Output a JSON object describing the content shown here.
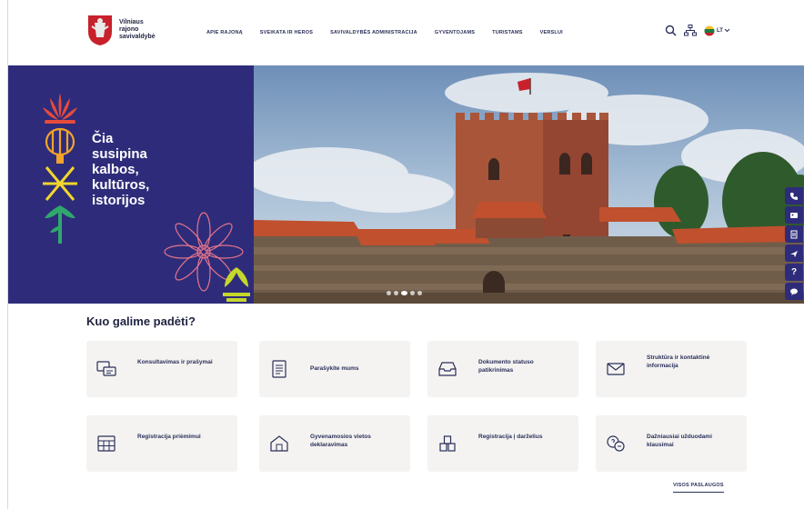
{
  "header": {
    "logo_lines": [
      "Vilniaus",
      "rajono",
      "savivaldybė"
    ],
    "nav": [
      "APIE RAJONĄ",
      "SVEIKATA IR HEROS",
      "SAVIVALDYBĖS ADMINISTRACIJA",
      "GYVENTOJAMS",
      "TURISTAMS",
      "VERSLUI"
    ],
    "language": "LT"
  },
  "hero": {
    "title_lines": [
      "Čia",
      "susipina",
      "kalbos,",
      "kultūros,",
      "istorijos"
    ],
    "slides": 5,
    "active_slide": 2,
    "side_buttons": [
      "phone-icon",
      "id-card-icon",
      "accessibility-icon",
      "plane-icon",
      "help-icon",
      "chat-icon"
    ]
  },
  "services": {
    "title": "Kuo galime padėti?",
    "items": [
      {
        "label": "Konsultavimas ir prašymai",
        "icon": "chat-bubbles-icon"
      },
      {
        "label": "Parašykite mums",
        "icon": "document-icon"
      },
      {
        "label": "Dokumento statuso patikrinimas",
        "icon": "inbox-icon"
      },
      {
        "label": "Struktūra ir kontaktinė informacija",
        "icon": "envelope-icon"
      },
      {
        "label": "Registracija priėmimui",
        "icon": "calendar-icon"
      },
      {
        "label": "Gyvenamosios vietos deklaravimas",
        "icon": "house-icon"
      },
      {
        "label": "Registracija į darželius",
        "icon": "blocks-icon"
      },
      {
        "label": "Dažniausiai užduodami klausimai",
        "icon": "question-bubbles-icon"
      }
    ],
    "all_link": "VISOS PASLAUGOS"
  },
  "colors": {
    "brand": "#2e2c7a",
    "card": "#f4f3f1"
  }
}
